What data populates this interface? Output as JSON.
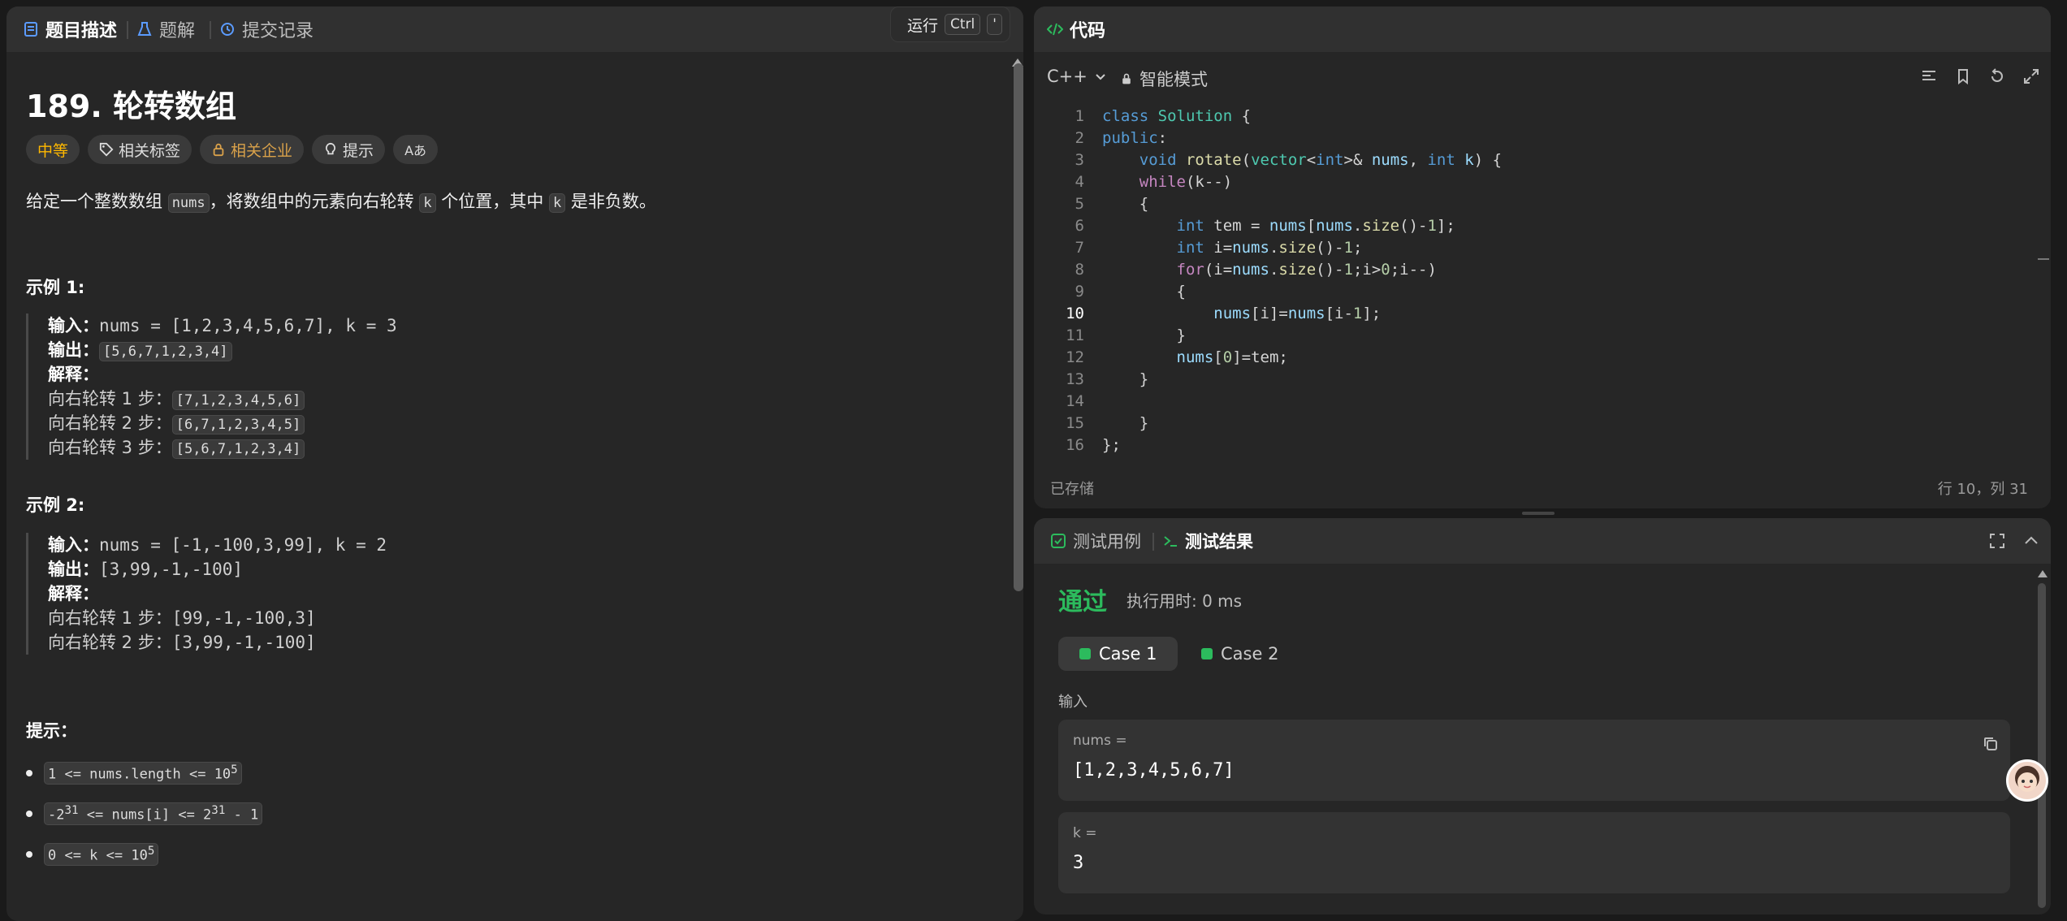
{
  "left_tabs": [
    {
      "label": "题目描述",
      "icon": "document-icon"
    },
    {
      "label": "题解",
      "icon": "flask-icon"
    },
    {
      "label": "提交记录",
      "icon": "history-icon"
    }
  ],
  "run": {
    "label": "运行",
    "key1": "Ctrl",
    "key2": "'"
  },
  "problem": {
    "title": "189. 轮转数组",
    "chips": {
      "difficulty": "中等",
      "tags": "相关标签",
      "companies": "相关企业",
      "hint": "提示",
      "font": "Aあ"
    },
    "desc_1": "给定一个整数数组 ",
    "desc_code_1": "nums",
    "desc_2": "，将数组中的元素向右轮转 ",
    "desc_code_2": "k",
    "desc_3": " 个位置，其中 ",
    "desc_code_3": "k",
    "desc_4": " 是非负数。"
  },
  "example1": {
    "title": "示例 1:",
    "input_label": "输入：",
    "input_value": "nums = [1,2,3,4,5,6,7], k = 3",
    "output_label": "输出：",
    "output_value": "[5,6,7,1,2,3,4]",
    "explain_label": "解释：",
    "steps": [
      {
        "text": "向右轮转 1 步：",
        "value": "[7,1,2,3,4,5,6]"
      },
      {
        "text": "向右轮转 2 步：",
        "value": "[6,7,1,2,3,4,5]"
      },
      {
        "text": "向右轮转 3 步：",
        "value": "[5,6,7,1,2,3,4]"
      }
    ]
  },
  "example2": {
    "title": "示例 2:",
    "input_label": "输入：",
    "input_value": "nums = [-1,-100,3,99], k = 2",
    "output_label": "输出：",
    "output_value": "[3,99,-1,-100]",
    "explain_label": "解释：",
    "steps": [
      {
        "text": "向右轮转 1 步：",
        "value": "[99,-1,-100,3]"
      },
      {
        "text": "向右轮转 2 步：",
        "value": "[3,99,-1,-100]"
      }
    ]
  },
  "hints": {
    "title": "提示：",
    "items": [
      {
        "pre": "1 <= nums.length <= 10",
        "sup": "5",
        "post": ""
      },
      {
        "pre": "-2",
        "sup": "31",
        "mid": " <= nums[i] <= 2",
        "sup2": "31",
        "post": " - 1"
      },
      {
        "pre": "0 <= k <= 10",
        "sup": "5",
        "post": ""
      }
    ]
  },
  "code": {
    "tab_label": "代码",
    "language": "C++",
    "mode": "智能模式",
    "saved": "已存储",
    "position": "行 10，列 31",
    "current_line": 10
  },
  "test": {
    "tab_cases": "测试用例",
    "tab_results": "测试结果",
    "status": "通过",
    "runtime": "执行用时: 0 ms",
    "cases": [
      "Case 1",
      "Case 2"
    ],
    "input_label": "输入",
    "vars": [
      {
        "name": "nums =",
        "value": "[1,2,3,4,5,6,7]"
      },
      {
        "name": "k =",
        "value": "3"
      }
    ]
  },
  "colors": {
    "pass": "#2cbb5d",
    "medium": "#ffb800",
    "panel": "#262626",
    "header": "#303030"
  }
}
